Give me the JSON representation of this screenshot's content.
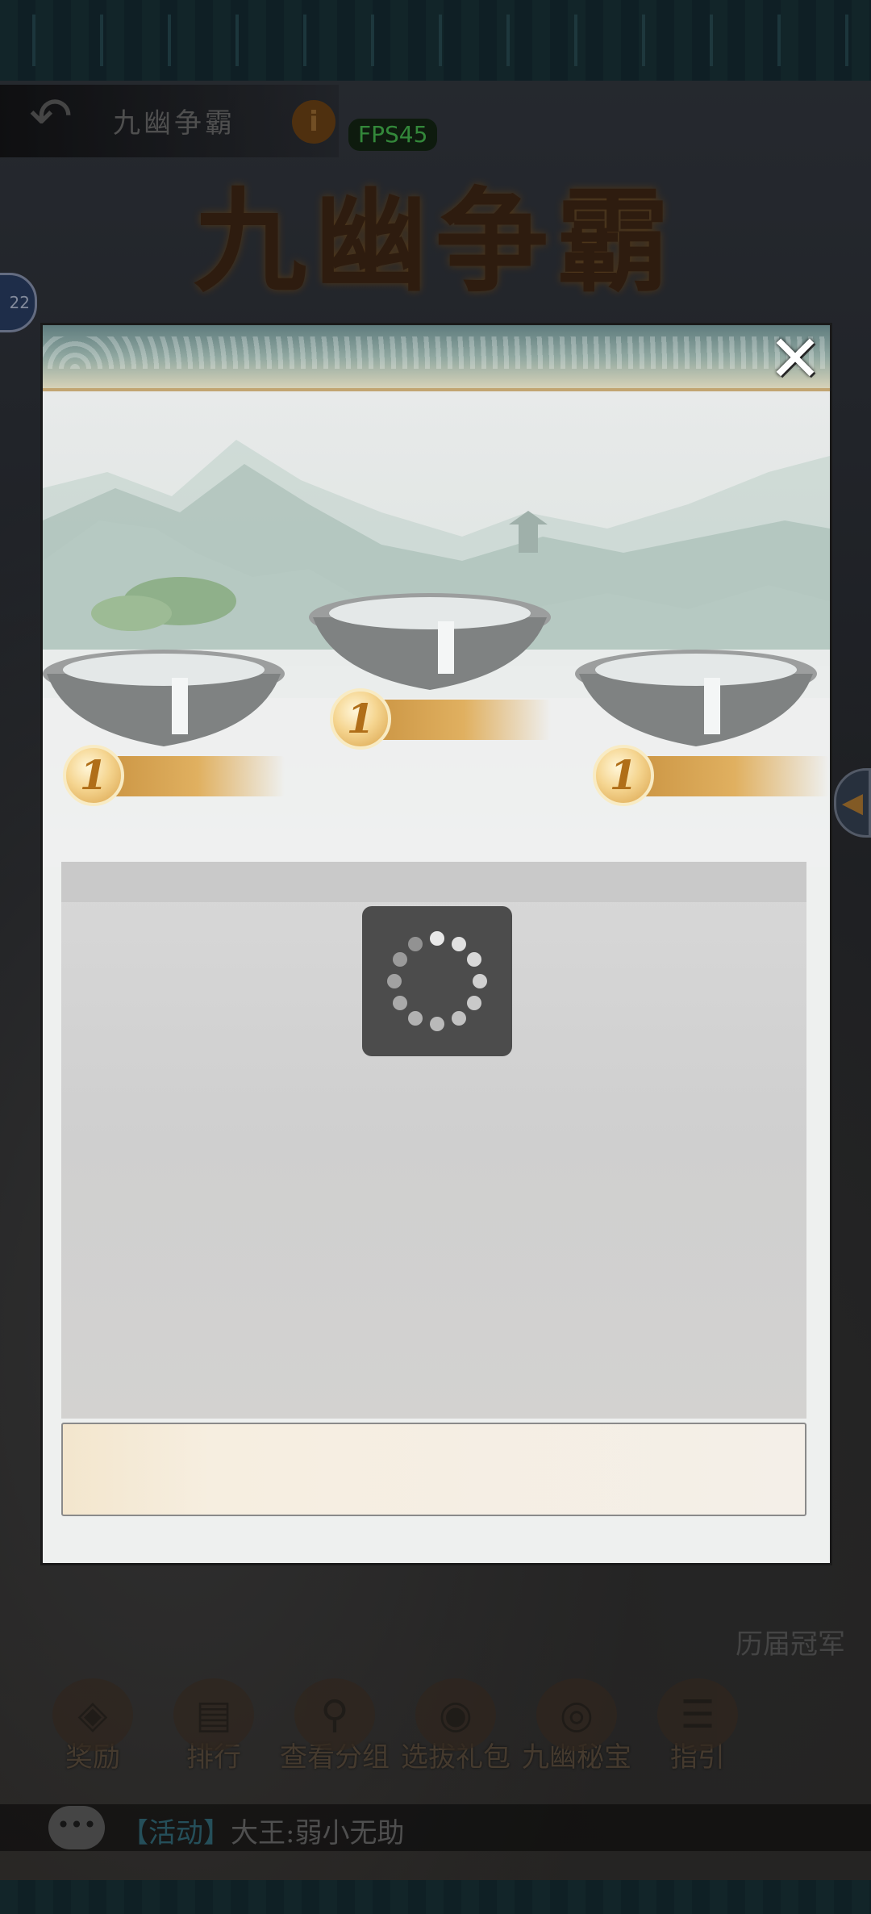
{
  "header": {
    "back_icon": "back-arrow-icon",
    "title": "九幽争霸",
    "info_label": "i",
    "fps": "FPS45"
  },
  "banner_title": "九幽争霸",
  "left_badge": "22",
  "modal": {
    "close_icon": "close-icon",
    "platforms": [
      {
        "coin": "1"
      },
      {
        "coin": "1"
      },
      {
        "coin": "1"
      }
    ],
    "loading_icon": "loading-spinner-icon"
  },
  "sidebar_right": {
    "champion_label": "历届冠军"
  },
  "bottom_nav": {
    "items": [
      {
        "label": "奖励",
        "icon": "reward-icon"
      },
      {
        "label": "排行",
        "icon": "ranking-icon"
      },
      {
        "label": "查看分组",
        "icon": "group-search-icon"
      },
      {
        "label": "选拔礼包",
        "icon": "gift-bag-icon"
      },
      {
        "label": "九幽秘宝",
        "icon": "treasure-icon"
      },
      {
        "label": "指引",
        "icon": "guide-book-icon"
      }
    ]
  },
  "chat": {
    "tag": "【活动】",
    "message": "大王:弱小无助"
  }
}
